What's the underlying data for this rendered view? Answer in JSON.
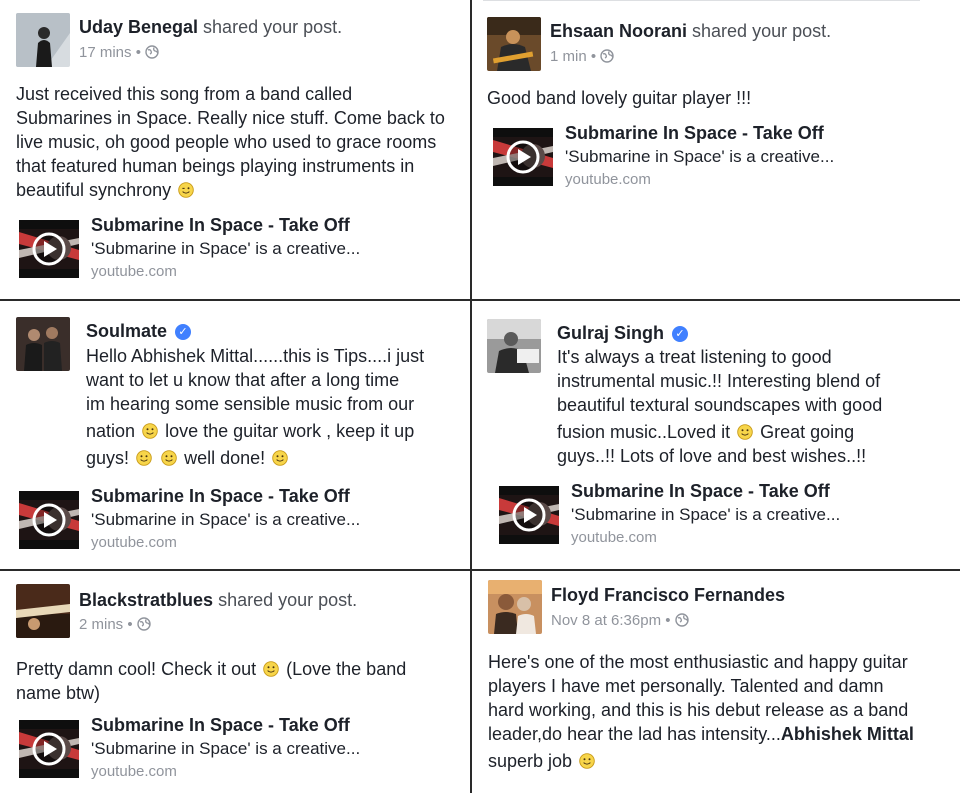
{
  "link_card": {
    "title": "Submarine In Space - Take Off",
    "description": "'Submarine in Space' is a creative...",
    "domain": "youtube.com"
  },
  "posts": [
    {
      "name": "Uday Benegal",
      "action": " shared your post.",
      "time": "17 mins",
      "lines": [
        "Just received this song from a band called",
        "Submarines in Space. Really nice stuff. Come back to",
        "live music, oh good people who used to grace rooms",
        "that featured human beings playing instruments in",
        "beautiful synchrony"
      ]
    },
    {
      "name": "Ehsaan Noorani",
      "action": " shared your post.",
      "time": "1 min",
      "lines": [
        "Good band lovely guitar player !!!"
      ]
    },
    {
      "name": "Soulmate",
      "lines": [
        "Hello Abhishek Mittal......this is Tips....i just",
        "want to let u know that after a long time",
        "im hearing some sensible music from our",
        "nation",
        " love the guitar work , keep it up",
        "guys!",
        "well done!"
      ]
    },
    {
      "name": "Gulraj Singh",
      "lines": [
        "It's always a treat listening to good",
        "instrumental music.!! Interesting blend of",
        "beautiful textural soundscapes with good",
        "fusion music..Loved it",
        " Great going",
        "guys..!! Lots of love and best wishes..!!"
      ]
    },
    {
      "name": "Blackstratblues",
      "action": " shared your post.",
      "time": "2 mins",
      "lines": [
        "Pretty damn cool! Check it out",
        " (Love the band",
        "name btw)"
      ]
    },
    {
      "name": "Floyd Francisco Fernandes",
      "time": "Nov 8 at 6:36pm",
      "lines": [
        "Here's one of the most enthusiastic and happy guitar",
        "players I have met personally. Talented and damn",
        "hard working, and this is his debut release as a band",
        "leader,do hear the lad has intensity...",
        "Abhishek Mittal",
        "superb job"
      ]
    }
  ],
  "separator": "•",
  "icons": {
    "globe": "globe-icon",
    "verified": "verified-badge-icon",
    "emoji": "smiley-emoji-icon",
    "play": "play-icon"
  },
  "colors": {
    "name": "#1d2129",
    "meta": "#90949c",
    "verified": "#4080ff",
    "divider": "#2a2a2a"
  }
}
